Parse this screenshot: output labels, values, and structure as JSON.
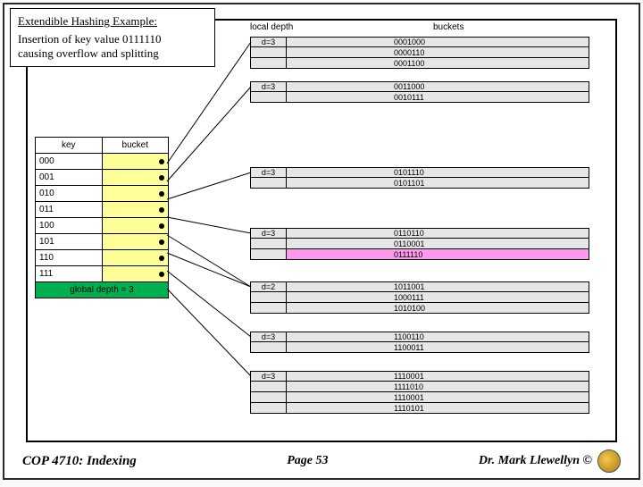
{
  "title": {
    "heading": "Extendible Hashing Example:",
    "subheading_l1": "Insertion of key value 0111110",
    "subheading_l2": "causing overflow and splitting"
  },
  "column_headers": {
    "local_depth": "local depth",
    "buckets": "buckets"
  },
  "directory": {
    "col_key": "key",
    "col_bucket": "bucket",
    "rows": [
      "000",
      "001",
      "010",
      "011",
      "100",
      "101",
      "110",
      "111"
    ],
    "global_depth_label": "global depth = 3"
  },
  "buckets": [
    {
      "ld": "d=3",
      "vals": [
        "0001000",
        "0000110",
        "0001100"
      ]
    },
    {
      "ld": "d=3",
      "vals": [
        "0011000",
        "0010111"
      ]
    },
    {
      "ld": "d=3",
      "vals": [
        "0101110",
        "0101101"
      ]
    },
    {
      "ld": "d=3",
      "vals": [
        "0110110",
        "0110001",
        "0111110"
      ],
      "highlight_index": 2
    },
    {
      "ld": "d=2",
      "vals": [
        "1011001",
        "1000111",
        "1010100"
      ]
    },
    {
      "ld": "d=3",
      "vals": [
        "1100110",
        "1100011"
      ]
    },
    {
      "ld": "d=3",
      "vals": [
        "1110001",
        "1111010",
        "1110001",
        "1110101"
      ]
    }
  ],
  "footer": {
    "left": "COP 4710: Indexing",
    "mid": "Page 53",
    "right": "Dr. Mark Llewellyn ©"
  }
}
